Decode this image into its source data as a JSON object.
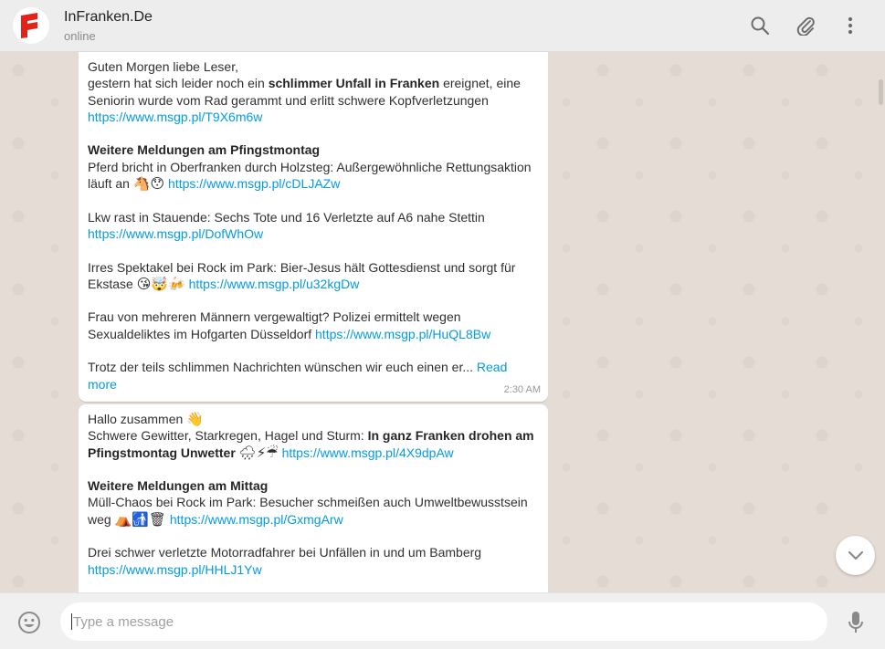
{
  "header": {
    "name": "InFranken.De",
    "status": "online",
    "icons": [
      "search-icon",
      "paperclip-icon",
      "menu-dots-icon"
    ]
  },
  "messages": [
    {
      "lines": {
        "l1": "Guten Morgen liebe Leser,",
        "l2a": "gestern hat sich leider noch ein ",
        "l2b": "schlimmer Unfall in Franken",
        "l2c": " ereignet, eine",
        "l3": "Seniorin wurde vom Rad gerammt und erlitt schwere Kopfverletzungen",
        "link1": "https://www.msgp.pl/T9X6m6w",
        "h1": "Weitere Meldungen am Pfingstmontag",
        "s1a": "Pferd bricht in Oberfranken durch Holzsteg: Außergewöhnliche Rettungsaktion",
        "s1b": "läuft an",
        "link2": "https://www.msgp.pl/cDLJAZw",
        "s2": "Lkw rast in Stauende: Sechs Tote und 16 Verletzte auf A6 nahe Stettin",
        "link3": "https://www.msgp.pl/DofWhOw",
        "s3a": "Irres Spektakel bei Rock im Park: Bier-Jesus hält Gottesdienst und sorgt für",
        "s3b": "Ekstase",
        "link4": "https://www.msgp.pl/u32kgDw",
        "s4a": "Frau von mehreren Männern vergewaltigt? Polizei ermittelt wegen",
        "s4b": "Sexualdeliktes im Hofgarten Düsseldorf",
        "link5": "https://www.msgp.pl/HuQL8Bw",
        "s5": "Trotz der teils schlimmen Nachrichten wünschen wir euch einen er...",
        "read_more_a": "Read",
        "read_more_b": "more"
      },
      "emoji": {
        "e1": "🐴😯",
        "e2": "😘🤯🍻"
      },
      "time": "2:30 AM"
    },
    {
      "lines": {
        "l1": "Hallo zusammen",
        "l2a": "Schwere Gewitter, Starkregen, Hagel und Sturm: ",
        "l2b": "In ganz Franken drohen am",
        "l3a": "Pfingstmontag Unwetter",
        "link1": "https://www.msgp.pl/4X9dpAw",
        "h1": "Weitere Meldungen am Mittag",
        "s1a": "Müll-Chaos bei Rock im Park: Besucher schmeißen auch Umweltbewusstsein",
        "s1b": "weg",
        "link2": "https://www.msgp.pl/GxmgArw",
        "s2": "Drei schwer verletzte Motorradfahrer bei Unfällen in und um Bamberg",
        "link3": "https://www.msgp.pl/HHLJ1Yw"
      },
      "emoji": {
        "e0": "👋",
        "e1": "🌧⚡☔",
        "e2": "⛺🚮🗑"
      }
    }
  ],
  "composer": {
    "placeholder": "Type a message"
  },
  "colors": {
    "header_bg": "#ededed",
    "chat_bg": "#e5ddd5",
    "link": "#039be5",
    "brand_red": "#e2231a"
  }
}
